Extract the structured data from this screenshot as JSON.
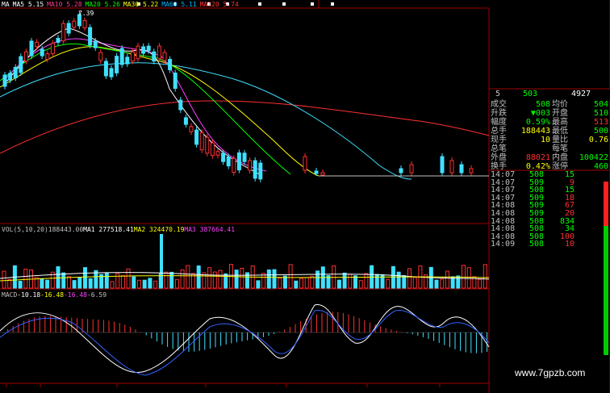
{
  "price_chart": {
    "ma_legend": [
      {
        "label": "MA",
        "color": "#ffffff"
      },
      {
        "label": "MA5 5.15",
        "color": "#ffffff"
      },
      {
        "label": "MA10 5.28",
        "color": "#ff3c8c"
      },
      {
        "label": "MA20 5.26",
        "color": "#00ff00"
      },
      {
        "label": "MA30 5.22",
        "color": "#ffff00"
      },
      {
        "label": "MA60 5.11",
        "color": "#00b4ff"
      },
      {
        "label": "MA120 5.74",
        "color": "#ff3030"
      }
    ],
    "high_annotation": "7.39",
    "colors": {
      "up": "#ff3030",
      "down": "#40e0ff",
      "axis": "#a00000"
    }
  },
  "volume_chart": {
    "legend": [
      {
        "label": "VOL(5,10,20)",
        "color": "#c0c0c0"
      },
      {
        "label": "188443.00",
        "color": "#c0c0c0"
      },
      {
        "label": "MA1 277518.41",
        "color": "#ffffff"
      },
      {
        "label": "MA2 324470.19",
        "color": "#ffff00"
      },
      {
        "label": "MA3 387664.41",
        "color": "#ff40ff"
      }
    ]
  },
  "macd_chart": {
    "legend": [
      {
        "label": "MACD",
        "color": "#c0c0c0"
      },
      {
        "label": "-10.18",
        "color": "#ffffff"
      },
      {
        "label": "-16.48",
        "color": "#ffff00"
      },
      {
        "label": "-16.48",
        "color": "#ff40ff"
      },
      {
        "label": "-6.59",
        "color": "#c0c0c0"
      }
    ]
  },
  "quote_panel": {
    "header": {
      "left": "5",
      "mid": "503",
      "right": "4927"
    },
    "rows": [
      {
        "l1": "成交",
        "v1": "508",
        "l2": "均价",
        "v2": "504",
        "c1": "#00ff00",
        "c2": "#00ff00"
      },
      {
        "l1": "升跌",
        "v1": "▼003",
        "l2": "开盘",
        "v2": "510",
        "c1": "#00ff00",
        "c2": "#00ff00"
      },
      {
        "l1": "幅度",
        "v1": "0.59%",
        "l2": "最高",
        "v2": "513",
        "c1": "#00ff00",
        "c2": "#ff3030"
      },
      {
        "l1": "总手",
        "v1": "188443",
        "l2": "最低",
        "v2": "500",
        "c1": "#ffff00",
        "c2": "#00ff00"
      },
      {
        "l1": "现手",
        "v1": "10",
        "l2": "量比",
        "v2": "0.76",
        "c1": "#ffff00",
        "c2": "#ffff00"
      },
      {
        "l1": "总笔",
        "v1": "",
        "l2": "每笔",
        "v2": "",
        "c1": "#ffff00",
        "c2": "#ffff00"
      },
      {
        "l1": "外盘",
        "v1": "88021",
        "l2": "内盘",
        "v2": "100422",
        "c1": "#ff3030",
        "c2": "#00ff00"
      },
      {
        "l1": "换手",
        "v1": "0.42%",
        "l2": "涨停",
        "v2": "460",
        "c1": "#ffff00",
        "c2": "#00ff00"
      }
    ],
    "trades": [
      {
        "time": "14:07",
        "price": "508",
        "vol": "15",
        "vcolor": "#00ff00"
      },
      {
        "time": "14:07",
        "price": "509",
        "vol": "9",
        "vcolor": "#ff3030"
      },
      {
        "time": "14:07",
        "price": "508",
        "vol": "15",
        "vcolor": "#00ff00"
      },
      {
        "time": "14:07",
        "price": "509",
        "vol": "18",
        "vcolor": "#ff3030"
      },
      {
        "time": "14:08",
        "price": "509",
        "vol": "67",
        "vcolor": "#ff3030"
      },
      {
        "time": "14:08",
        "price": "509",
        "vol": "20",
        "vcolor": "#ff3030"
      },
      {
        "time": "14:08",
        "price": "508",
        "vol": "834",
        "vcolor": "#00ff00"
      },
      {
        "time": "14:08",
        "price": "508",
        "vol": "34",
        "vcolor": "#00ff00"
      },
      {
        "time": "14:08",
        "price": "508",
        "vol": "100",
        "vcolor": "#ff3030"
      },
      {
        "time": "14:09",
        "price": "508",
        "vol": "10",
        "vcolor": "#ff3030"
      }
    ]
  },
  "watermark": "www.7gpzb.com",
  "chart_data": [
    {
      "type": "candlestick",
      "title": "",
      "ma_values": {
        "MA5": 5.15,
        "MA10": 5.28,
        "MA20": 5.26,
        "MA30": 5.22,
        "MA60": 5.11,
        "MA120": 5.74
      },
      "annotations": [
        "7.39"
      ]
    },
    {
      "type": "bar",
      "title": "VOL(5,10,20)",
      "values_latest": 188443.0,
      "MA1": 277518.41,
      "MA2": 324470.19,
      "MA3": 387664.41
    },
    {
      "type": "bar",
      "title": "MACD",
      "values": [
        -10.18,
        -16.48,
        -16.48,
        -6.59
      ]
    }
  ]
}
